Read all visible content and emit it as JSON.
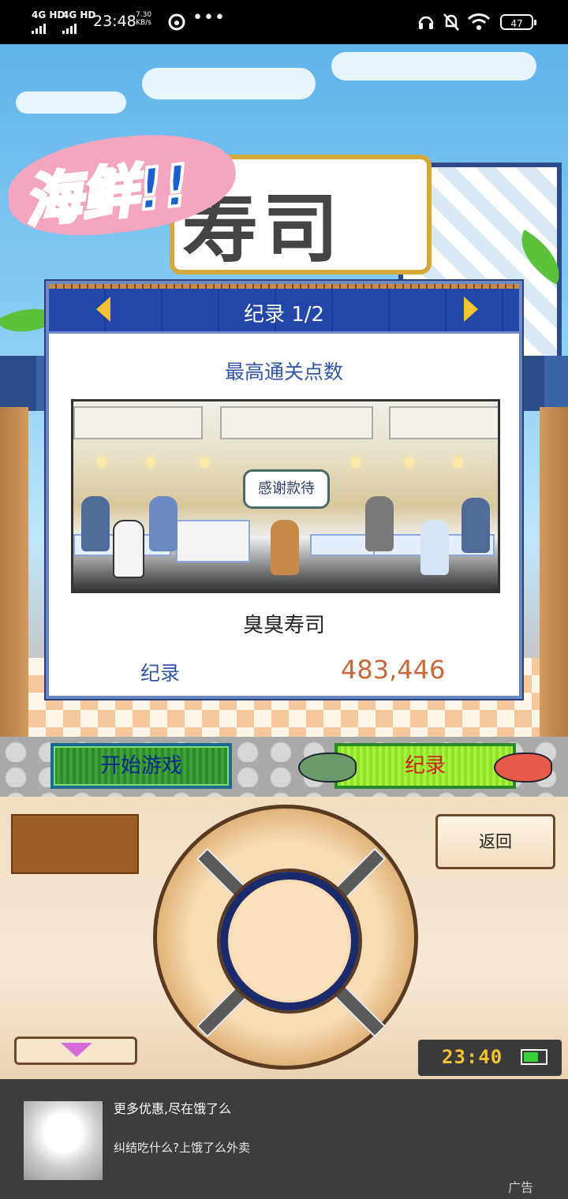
{
  "status_bar": {
    "network1": "4G HD",
    "network2": "4G HD",
    "time": "23:48",
    "speed_value": "7.30",
    "speed_unit": "KB/s",
    "icons": [
      "netease-music-icon",
      "more-dots-icon",
      "headset-icon",
      "mute-bell-icon",
      "wifi-icon",
      "battery-icon"
    ],
    "more": "•••",
    "battery": "47"
  },
  "game": {
    "logo_line1": "海鲜!!",
    "logo_line2": "寿司",
    "record_panel": {
      "title": "纪录 1/2",
      "subtitle": "最高通关点数",
      "speech_bubble": "感谢款待",
      "shop_name": "臭臭寿司",
      "record_label": "纪录",
      "record_value": "483,446"
    },
    "buttons": {
      "start": "开始游戏",
      "record": "纪录",
      "back": "返回"
    },
    "clock": "23:40",
    "colors": {
      "accent_blue": "#2247a8",
      "value_orange": "#c66a3b",
      "start_green": "#3fa23a",
      "record_green": "#a8f23e"
    }
  },
  "ad": {
    "title": "更多优惠,尽在饿了么",
    "description": "纠结吃什么?上饿了么外卖",
    "tag": "广告"
  }
}
